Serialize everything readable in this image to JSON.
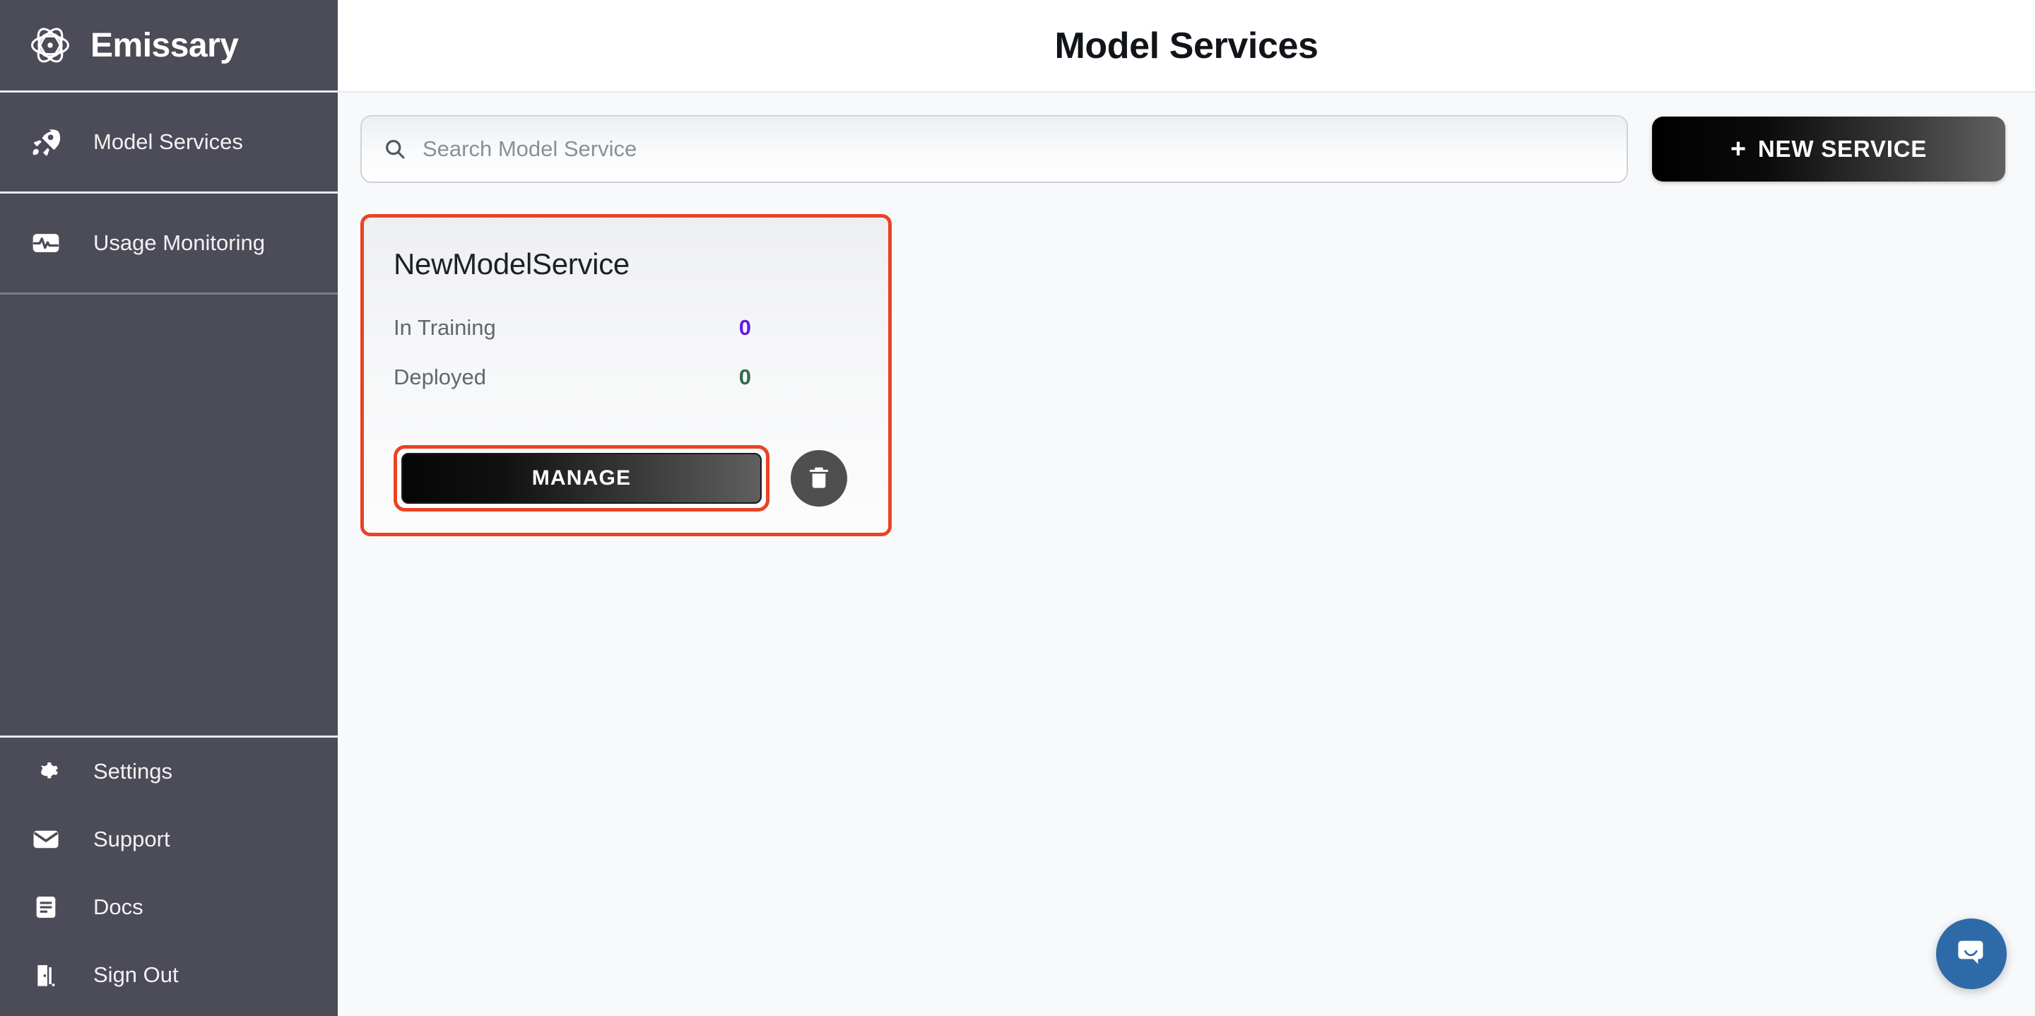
{
  "sidebar": {
    "brand": {
      "name": "Emissary",
      "logo_icon": "atom-orbit-icon"
    },
    "primary_items": [
      {
        "label": "Model Services",
        "icon": "rocket-icon",
        "active": true
      },
      {
        "label": "Usage Monitoring",
        "icon": "activity-monitor-icon",
        "active": false
      }
    ],
    "secondary_items": [
      {
        "label": "Settings",
        "icon": "gear-icon"
      },
      {
        "label": "Support",
        "icon": "envelope-icon"
      },
      {
        "label": "Docs",
        "icon": "document-lines-icon"
      },
      {
        "label": "Sign Out",
        "icon": "exit-door-icon"
      }
    ]
  },
  "header": {
    "title": "Model Services"
  },
  "toolbar": {
    "search": {
      "placeholder": "Search Model Service",
      "value": "",
      "icon": "search-icon"
    },
    "new_service": {
      "plus": "+",
      "label": "NEW SERVICE"
    }
  },
  "services": [
    {
      "name": "NewModelService",
      "stats": [
        {
          "label": "In Training",
          "value": "0",
          "color": "#6519e0"
        },
        {
          "label": "Deployed",
          "value": "0",
          "color": "#2e6b4b"
        }
      ],
      "manage_label": "MANAGE",
      "delete_icon": "trash-icon",
      "highlighted": true,
      "manage_highlighted": true
    }
  ],
  "chat": {
    "icon": "chat-bubble-smile-icon"
  },
  "colors": {
    "sidebar_bg": "#4b4c57",
    "content_bg": "#f7f9fb",
    "highlight": "#ea4325",
    "accent_purple": "#6519e0",
    "accent_green": "#2e6b4b",
    "chat_blue": "#2f6aa8"
  }
}
